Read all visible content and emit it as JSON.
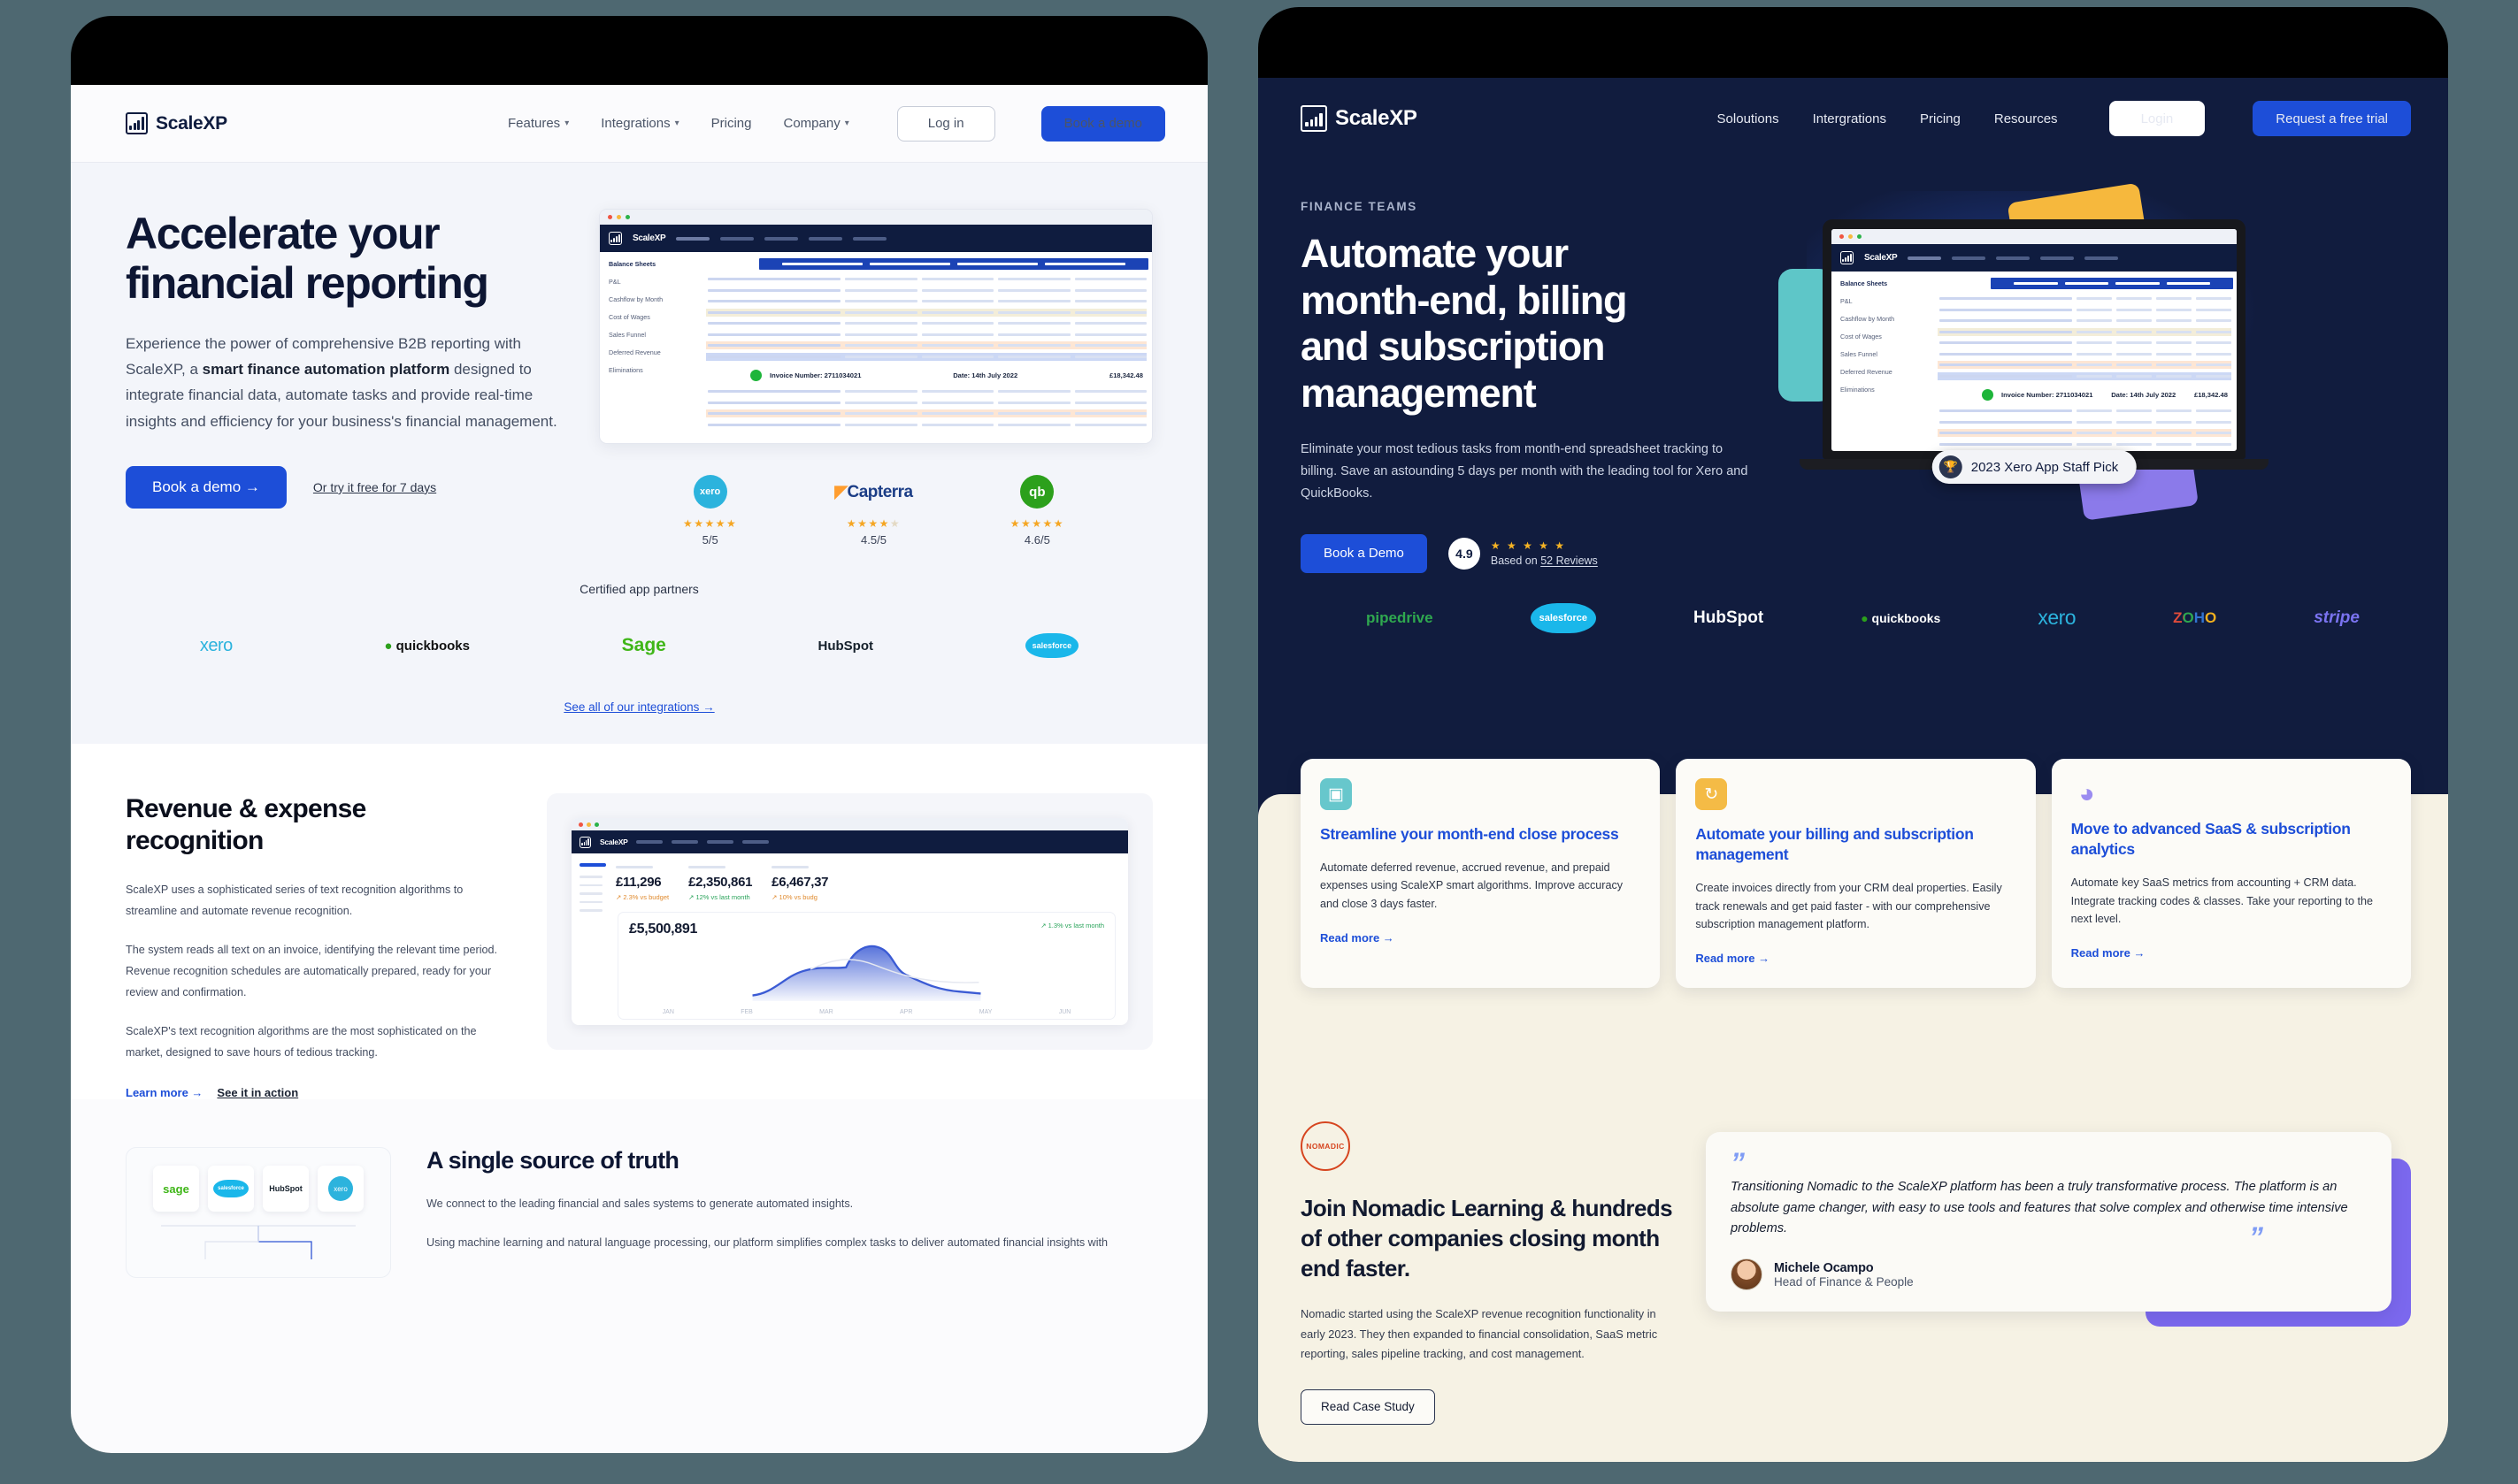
{
  "left": {
    "nav": {
      "brand": "ScaleXP",
      "links": [
        {
          "label": "Features",
          "caret": "▾"
        },
        {
          "label": "Integrations",
          "caret": "▾"
        },
        {
          "label": "Pricing",
          "caret": ""
        },
        {
          "label": "Company",
          "caret": "▾"
        }
      ],
      "login": "Log in",
      "demo": "Book a demo"
    },
    "hero": {
      "h1_line1": "Accelerate your",
      "h1_line2": "financial reporting",
      "sub_a": "Experience the power of comprehensive B2B reporting with ScaleXP, a ",
      "sub_bold": "smart finance automation platform",
      "sub_b": " designed to integrate financial data, automate tasks and provide real-time insights and efficiency for your business's financial management.",
      "cta": "Book a demo →",
      "cta_alt": "Or try it free for 7 days"
    },
    "dashboard": {
      "sidebar": [
        "Balance Sheets",
        "P&L",
        "Cashflow by Month",
        "Cost of Wages",
        "Sales Funnel",
        "Deferred Revenue",
        "Eliminations"
      ],
      "invoice_number": "Invoice Number: 2711034021",
      "invoice_date": "Date: 14th July 2022",
      "invoice_amount": "£18,342.48"
    },
    "ratings": [
      {
        "name": "xero",
        "stars": 5,
        "value": "5/5",
        "color": "#2cb3dd"
      },
      {
        "name": "Capterra",
        "stars": 4.5,
        "value": "4.5/5",
        "color": "#1b3d86"
      },
      {
        "name": "qb",
        "stars": 5,
        "value": "4.6/5",
        "color": "#2ca01c"
      }
    ],
    "partners": {
      "title": "Certified app partners",
      "logos": [
        "xero",
        "quickbooks",
        "Sage",
        "HubSpot",
        "salesforce"
      ],
      "see_all": "See all of our integrations →"
    },
    "revenue": {
      "h2": "Revenue & expense recognition",
      "p1": "ScaleXP uses a sophisticated series of text recognition algorithms to streamline and automate revenue recognition.",
      "p2": "The system reads all text on an invoice, identifying the relevant time period. Revenue recognition schedules are automatically prepared, ready for your review and confirmation.",
      "p3": "ScaleXP's text recognition algorithms are the most sophisticated on the market, designed to save hours of tedious tracking.",
      "link1": "Learn more →",
      "link2": "See it in action"
    },
    "mini_dashboard": {
      "kpis": [
        {
          "value": "£11,296",
          "delta": "↗ 2.3% vs budget"
        },
        {
          "value": "£2,350,861",
          "delta": "↗ 12% vs last month"
        },
        {
          "value": "£6,467,37",
          "delta": "↗ 10% vs budg"
        }
      ],
      "chart_total": "£5,500,891",
      "chart_delta": "↗ 1.3% vs last month",
      "months": [
        "JAN",
        "FEB",
        "MAR",
        "APR",
        "MAY",
        "JUN"
      ]
    },
    "truth": {
      "h2": "A single source of truth",
      "p1": "We connect to the leading financial and sales systems to generate automated insights.",
      "p2": "Using machine learning and natural language processing, our platform simplifies complex tasks to deliver automated financial insights with",
      "tiles": [
        "sage",
        "salesforce",
        "HubSpot",
        "xero"
      ]
    }
  },
  "right": {
    "nav": {
      "brand": "ScaleXP",
      "links": [
        "Soloutions",
        "Intergrations",
        "Pricing",
        "Resources"
      ],
      "login": "Login",
      "trial": "Request a free trial"
    },
    "hero": {
      "eyebrow": "FINANCE TEAMS",
      "h1_line1": "Automate your",
      "h1_line2": "month-end, billing",
      "h1_line3": "and subscription",
      "h1_line4": "management",
      "sub": "Eliminate your most tedious tasks from month-end spreadsheet tracking to billing.  Save an astounding 5 days per month with the leading tool for Xero and QuickBooks.",
      "cta": "Book a Demo",
      "score": "4.9",
      "stars": "★ ★ ★ ★ ★",
      "score_sub_a": "Based on ",
      "score_sub_b": "52 Reviews",
      "xero_badge": "2023 Xero App Staff Pick"
    },
    "laptop": {
      "sidebar": [
        "Balance Sheets",
        "P&L",
        "Cashflow by Month",
        "Cost of Wages",
        "Sales Funnel",
        "Deferred Revenue",
        "Eliminations"
      ],
      "invoice_number": "Invoice Number: 2711034021",
      "invoice_date": "Date: 14th July 2022",
      "invoice_amount": "£18,342.48"
    },
    "logos": [
      "pipedrive",
      "salesforce",
      "HubSpot",
      "quickbooks",
      "xero",
      "ZOHO",
      "stripe"
    ],
    "cards": [
      {
        "icon": "calendar-check-icon",
        "icon_glyph": "▣",
        "icon_color": "#67c7cc",
        "title": "Streamline your month-end close process",
        "body": "Automate deferred revenue, accrued revenue, and prepaid expenses using ScaleXP smart algorithms. Improve accuracy and close 3 days faster.",
        "link": "Read more  →"
      },
      {
        "icon": "refresh-icon",
        "icon_glyph": "↻",
        "icon_color": "#f4bb46",
        "title": "Automate your billing and subscription management",
        "body": "Create invoices directly from your CRM deal properties. Easily track renewals and get paid faster - with our comprehensive subscription management platform.",
        "link": "Read more  →"
      },
      {
        "icon": "pie-chart-icon",
        "icon_glyph": "◕",
        "icon_color": "#9b8cf0",
        "title": "Move to advanced SaaS & subscription analytics",
        "body": "Automate key SaaS metrics from accounting + CRM data.  Integrate tracking codes & classes. Take your reporting to the next level.",
        "link": "Read more  →"
      }
    ],
    "nomadic": {
      "logo_text": "NOMADIC",
      "heading": "Join Nomadic Learning & hundreds of other companies closing month end faster.",
      "body": "Nomadic started using the ScaleXP revenue recognition functionality in early 2023. They then expanded to financial consolidation, SaaS metric reporting, sales pipeline tracking, and cost management.",
      "cta": "Read Case Study"
    },
    "testimonial": {
      "open_quote": "”",
      "close_quote": "”",
      "text": "Transitioning Nomadic to the ScaleXP platform has been a truly transformative process. The platform is an absolute game changer, with easy to use tools and features that solve complex and otherwise time intensive problems.",
      "name": "Michele Ocampo",
      "role": "Head of Finance & People"
    }
  },
  "colors": {
    "brand_blue": "#1d4ed8",
    "navy": "#111c3e",
    "cream": "#f6f2e4",
    "page_bg": "#4e6871"
  }
}
